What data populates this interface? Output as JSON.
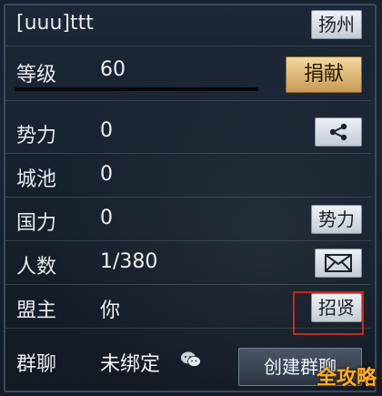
{
  "header": {
    "name": "[uuu]ttt",
    "city_button": "扬州"
  },
  "rows": [
    {
      "label": "等级",
      "value": "60",
      "button": "捐献"
    },
    {
      "label": "势力",
      "value": "0"
    },
    {
      "label": "城池",
      "value": "0"
    },
    {
      "label": "国力",
      "value": "0",
      "button": "势力"
    },
    {
      "label": "人数",
      "value": "1/380"
    },
    {
      "label": "盟主",
      "value": "你",
      "button": "招贤"
    },
    {
      "label": "群聊",
      "value": "未绑定",
      "button": "创建群聊"
    }
  ],
  "icons": {
    "share": "share-icon",
    "mail": "mail-icon",
    "wechat": "wechat-icon"
  },
  "watermark": "全攻略",
  "colors": {
    "accent_gold": "#d8ad6a",
    "highlight_red": "#d0241c",
    "watermark": "#ffb21a"
  }
}
